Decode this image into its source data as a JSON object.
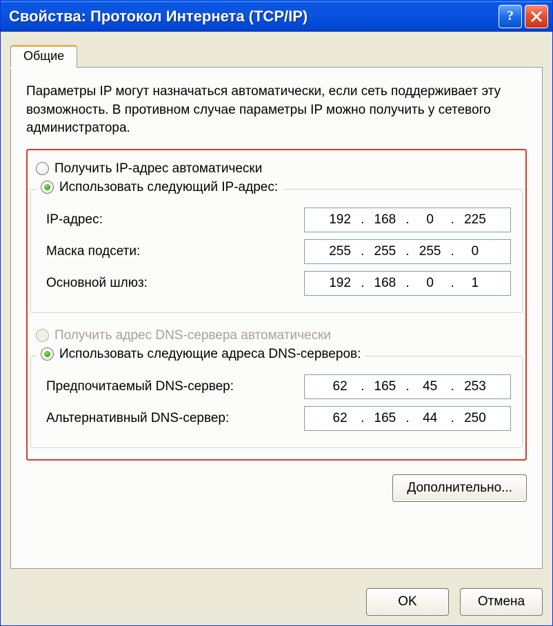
{
  "window": {
    "title": "Свойства: Протокол Интернета (TCP/IP)"
  },
  "tabs": {
    "general": "Общие"
  },
  "description": "Параметры IP могут назначаться автоматически, если сеть поддерживает эту возможность. В противном случае параметры IP можно получить у сетевого администратора.",
  "ip_section": {
    "auto_label": "Получить IP-адрес автоматически",
    "manual_label": "Использовать следующий IP-адрес:",
    "ip_label": "IP-адрес:",
    "mask_label": "Маска подсети:",
    "gateway_label": "Основной шлюз:",
    "ip": {
      "o1": "192",
      "o2": "168",
      "o3": "0",
      "o4": "225"
    },
    "mask": {
      "o1": "255",
      "o2": "255",
      "o3": "255",
      "o4": "0"
    },
    "gateway": {
      "o1": "192",
      "o2": "168",
      "o3": "0",
      "o4": "1"
    }
  },
  "dns_section": {
    "auto_label": "Получить адрес DNS-сервера автоматически",
    "manual_label": "Использовать следующие адреса DNS-серверов:",
    "pref_label": "Предпочитаемый DNS-сервер:",
    "alt_label": "Альтернативный DNS-сервер:",
    "pref": {
      "o1": "62",
      "o2": "165",
      "o3": "45",
      "o4": "253"
    },
    "alt": {
      "o1": "62",
      "o2": "165",
      "o3": "44",
      "o4": "250"
    }
  },
  "buttons": {
    "advanced": "Дополнительно...",
    "ok": "OK",
    "cancel": "Отмена"
  }
}
